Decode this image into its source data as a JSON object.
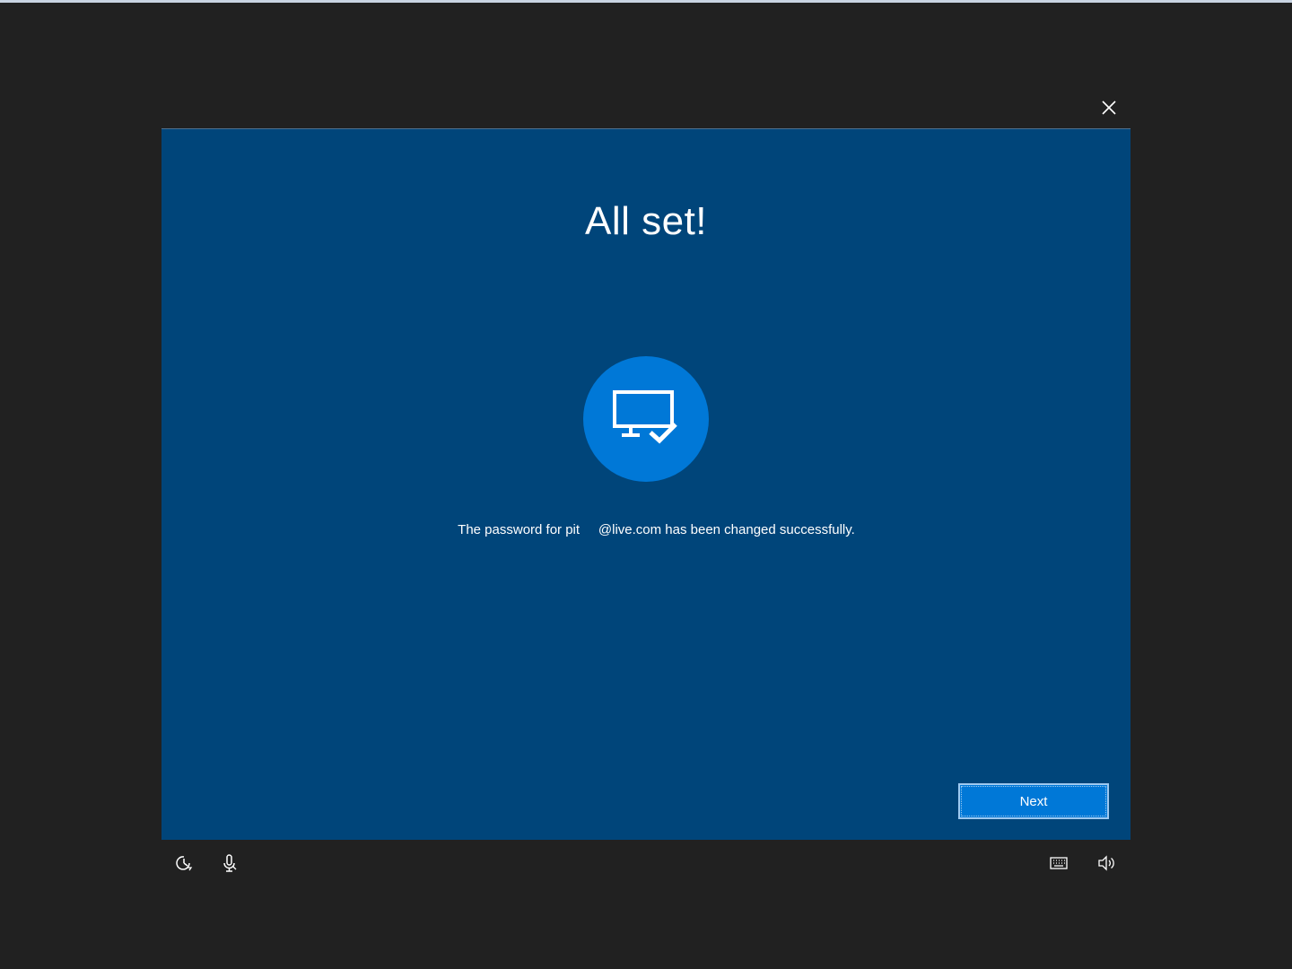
{
  "dialog": {
    "title": "All set!",
    "message": "The password for pit     @live.com has been changed successfully.",
    "next_label": "Next"
  },
  "icons": {
    "close": "close-icon",
    "status": "monitor-check-icon",
    "ease_of_access": "ease-of-access-icon",
    "microphone": "microphone-icon",
    "keyboard": "keyboard-icon",
    "volume": "volume-icon"
  },
  "colors": {
    "page_background": "#212121",
    "dialog_background": "#00457a",
    "accent": "#0078d7",
    "text": "#ffffff"
  }
}
